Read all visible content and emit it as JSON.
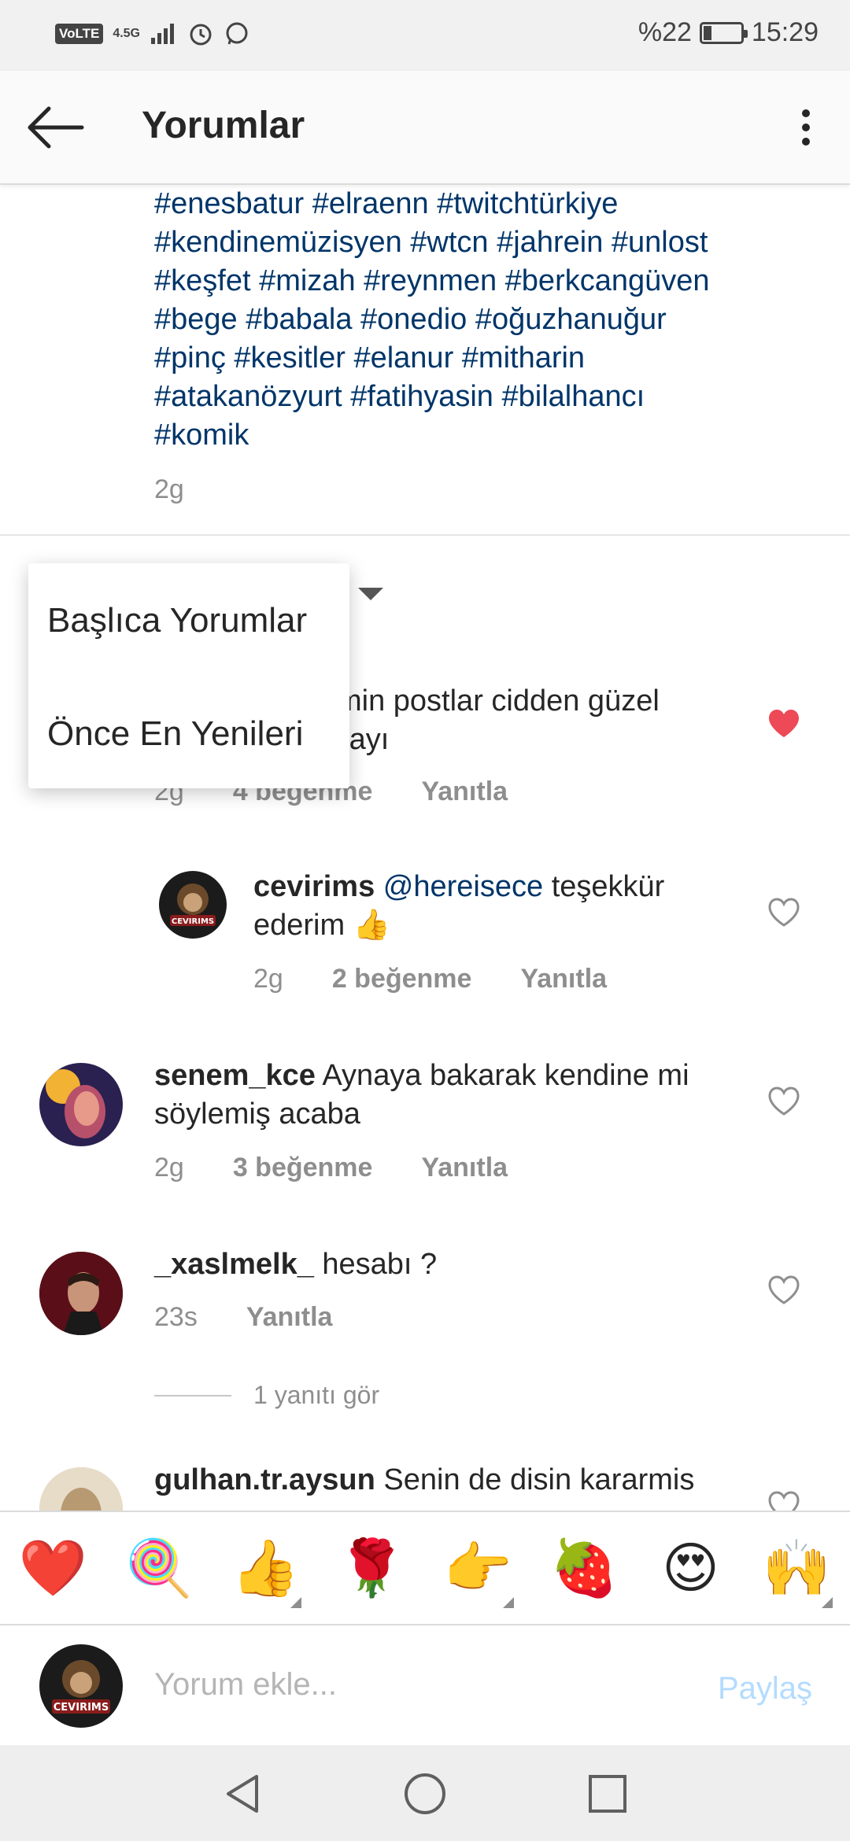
{
  "status_bar": {
    "volte": "VoLTE",
    "network": "4.5G",
    "battery": "%22",
    "battery_level": 0.22,
    "time": "15:29",
    "icons": [
      "signal-icon",
      "alarm-icon",
      "whatsapp-icon"
    ]
  },
  "header": {
    "title": "Yorumlar",
    "back_icon": "arrow-left-icon",
    "more_icon": "more-vertical-icon"
  },
  "caption": {
    "lines": [
      "#enesbatur #elraenn #twitchtürkiye",
      "#kendinemüzisyen #wtcn #jahrein #unlost",
      "#keşfet #mizah #reynmen #berkcangüven",
      "#bege #babala #onedio #oğuzhanuğur",
      "#pinç #kesitler #elanur #mitharin",
      "#atakanözyurt #fatihyasin #bilalhancı",
      "#komik"
    ],
    "time": "2g"
  },
  "sort_menu": {
    "items": [
      "Başlıca Yorumlar",
      "Önce En Yenileri"
    ]
  },
  "comments": [
    {
      "text_line1": "min postlar cidden güzel",
      "text_line2": "rayı",
      "time": "2g",
      "likes": "4 beğenme",
      "reply": "Yanıtla",
      "liked": true
    },
    {
      "username": "cevirims",
      "mention": "@hereisece",
      "text_a": " teşekkür",
      "text_b": "ederim 👍",
      "time": "2g",
      "likes": "2 beğenme",
      "reply": "Yanıtla",
      "avatar_label": "CEVIRIMS"
    },
    {
      "username": "senem_kce",
      "text_a": " Aynaya bakarak kendine mi",
      "text_b": "söylemiş acaba",
      "time": "2g",
      "likes": "3 beğenme",
      "reply": "Yanıtla"
    },
    {
      "username": "_xaslmelk_",
      "text_a": " hesabı ?",
      "time": "23s",
      "reply": "Yanıtla"
    },
    {
      "username": "gulhan.tr.aysun",
      "text_a": " Senin de disin kararmis"
    }
  ],
  "view_replies": "1 yanıtı gör",
  "emojis": [
    "❤️",
    "🍭",
    "👍",
    "🌹",
    "👉",
    "🍓",
    "😍",
    "🙌"
  ],
  "input": {
    "placeholder": "Yorum ekle...",
    "share": "Paylaş",
    "avatar_label": "CEVIRIMS"
  },
  "colors": {
    "hashtag": "#003569",
    "liked_heart": "#ed4956",
    "share_disabled": "#b3dbff",
    "muted": "#8e8e8e"
  }
}
